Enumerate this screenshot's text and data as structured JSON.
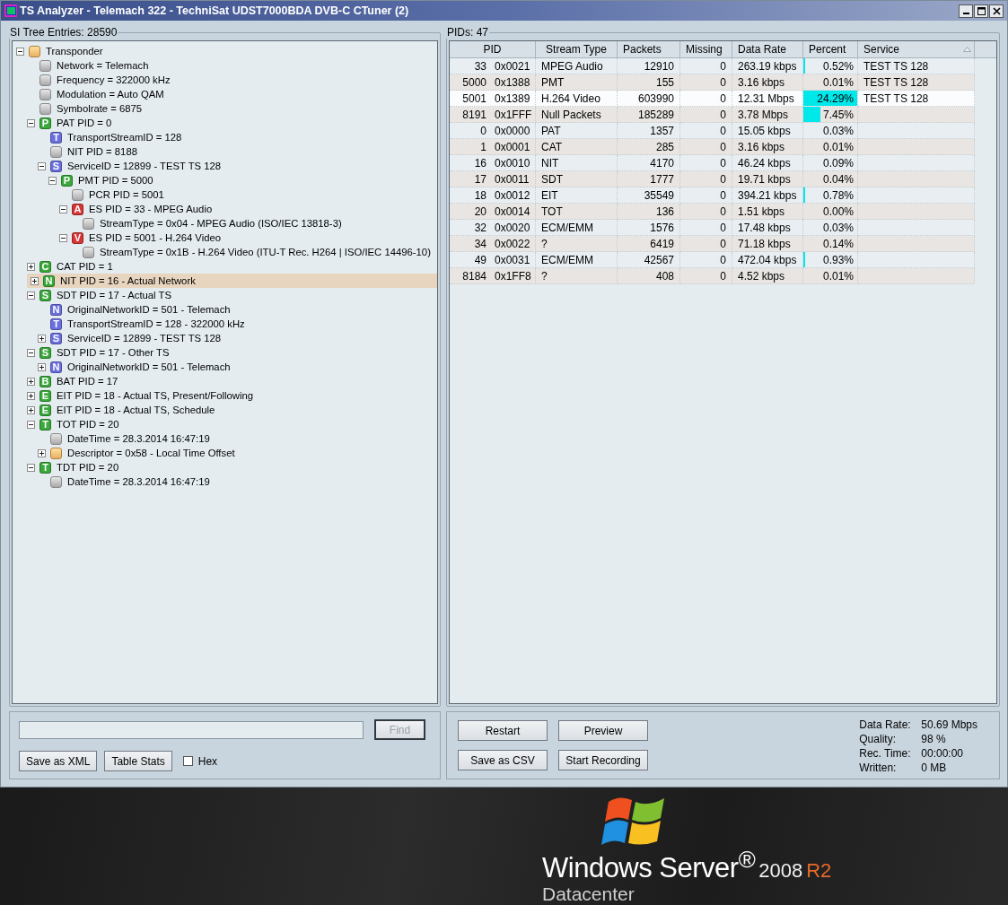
{
  "window": {
    "title": "TS Analyzer - Telemach 322 - TechniSat UDST7000BDA DVB-C CTuner (2)"
  },
  "tree_panel": {
    "title": "SI Tree Entries: 28590",
    "nodes": [
      {
        "label": "Transponder",
        "kind": "folder",
        "expanded": true,
        "selected": false,
        "children": [
          {
            "label": "Network = Telemach",
            "kind": "plain",
            "selected": false
          },
          {
            "label": "Frequency = 322000 kHz",
            "kind": "plain",
            "selected": false
          },
          {
            "label": "Modulation = Auto QAM",
            "kind": "plain",
            "selected": false
          },
          {
            "label": "Symbolrate = 6875",
            "kind": "plain",
            "selected": false
          },
          {
            "label": "PAT PID = 0",
            "kind": "letter",
            "badge": "P",
            "color": "#3aa83a",
            "expanded": true,
            "selected": false,
            "children": [
              {
                "label": "TransportStreamID = 128",
                "kind": "letter",
                "badge": "T",
                "color": "#6b6fe0",
                "selected": false
              },
              {
                "label": "NIT PID = 8188",
                "kind": "plain",
                "selected": false
              },
              {
                "label": "ServiceID = 12899 - TEST TS 128",
                "kind": "letter",
                "badge": "S",
                "color": "#6b6fe0",
                "expanded": true,
                "selected": false,
                "children": [
                  {
                    "label": "PMT PID = 5000",
                    "kind": "letter",
                    "badge": "P",
                    "color": "#3aa83a",
                    "expanded": true,
                    "selected": false,
                    "children": [
                      {
                        "label": "PCR PID = 5001",
                        "kind": "plain",
                        "selected": false
                      },
                      {
                        "label": "ES PID = 33 - MPEG Audio",
                        "kind": "letter",
                        "badge": "A",
                        "color": "#d83434",
                        "expanded": true,
                        "selected": false,
                        "children": [
                          {
                            "label": "StreamType = 0x04 - MPEG Audio (ISO/IEC 13818-3)",
                            "kind": "plain",
                            "selected": false
                          }
                        ]
                      },
                      {
                        "label": "ES PID = 5001 - H.264 Video",
                        "kind": "letter",
                        "badge": "V",
                        "color": "#d83434",
                        "expanded": true,
                        "selected": false,
                        "children": [
                          {
                            "label": "StreamType = 0x1B - H.264 Video (ITU-T Rec. H264 | ISO/IEC 14496-10)",
                            "kind": "plain",
                            "selected": false
                          }
                        ]
                      }
                    ]
                  }
                ]
              }
            ]
          },
          {
            "label": "CAT PID = 1",
            "kind": "letter",
            "badge": "C",
            "color": "#3aa83a",
            "expanded": false,
            "selected": false
          },
          {
            "label": "NIT PID = 16 - Actual Network",
            "kind": "letter",
            "badge": "N",
            "color": "#3aa83a",
            "expanded": false,
            "selected": true
          },
          {
            "label": "SDT PID = 17 - Actual TS",
            "kind": "letter",
            "badge": "S",
            "color": "#3aa83a",
            "expanded": true,
            "selected": false,
            "children": [
              {
                "label": "OriginalNetworkID = 501 - Telemach",
                "kind": "letter",
                "badge": "N",
                "color": "#6b6fe0",
                "selected": false
              },
              {
                "label": "TransportStreamID = 128 - 322000 kHz",
                "kind": "letter",
                "badge": "T",
                "color": "#6b6fe0",
                "selected": false
              },
              {
                "label": "ServiceID = 12899 - TEST TS 128",
                "kind": "letter",
                "badge": "S",
                "color": "#6b6fe0",
                "expanded": false,
                "selected": false
              }
            ]
          },
          {
            "label": "SDT PID = 17 - Other TS",
            "kind": "letter",
            "badge": "S",
            "color": "#3aa83a",
            "expanded": true,
            "selected": false,
            "children": [
              {
                "label": "OriginalNetworkID = 501 - Telemach",
                "kind": "letter",
                "badge": "N",
                "color": "#6b6fe0",
                "expanded": false,
                "selected": false
              }
            ]
          },
          {
            "label": "BAT PID = 17",
            "kind": "letter",
            "badge": "B",
            "color": "#3aa83a",
            "expanded": false,
            "selected": false
          },
          {
            "label": "EIT PID = 18 - Actual TS, Present/Following",
            "kind": "letter",
            "badge": "E",
            "color": "#3aa83a",
            "expanded": false,
            "selected": false
          },
          {
            "label": "EIT PID = 18 - Actual TS, Schedule",
            "kind": "letter",
            "badge": "E",
            "color": "#3aa83a",
            "expanded": false,
            "selected": false
          },
          {
            "label": "TOT PID = 20",
            "kind": "letter",
            "badge": "T",
            "color": "#3aa83a",
            "expanded": true,
            "selected": false,
            "children": [
              {
                "label": "DateTime = 28.3.2014 16:47:19",
                "kind": "plain",
                "selected": false
              },
              {
                "label": "Descriptor = 0x58 - Local Time Offset",
                "kind": "folder",
                "expanded": false,
                "selected": false
              }
            ]
          },
          {
            "label": "TDT PID = 20",
            "kind": "letter",
            "badge": "T",
            "color": "#3aa83a",
            "expanded": true,
            "selected": false,
            "children": [
              {
                "label": "DateTime = 28.3.2014 16:47:19",
                "kind": "plain",
                "selected": false
              }
            ]
          }
        ]
      }
    ]
  },
  "search": {
    "find_button": "Find",
    "find_disabled": true
  },
  "left_buttons": [
    "Save as XML",
    "Table Stats"
  ],
  "hex_checkbox": {
    "label": "Hex",
    "checked": false
  },
  "pid_panel": {
    "title": "PIDs: 47",
    "columns": [
      {
        "label": "PID",
        "sorted": false
      },
      {
        "label": "Stream Type",
        "sorted": false
      },
      {
        "label": "Packets",
        "sorted": false
      },
      {
        "label": "Missing",
        "sorted": false
      },
      {
        "label": "Data Rate",
        "sorted": false
      },
      {
        "label": "Percent",
        "sorted": false
      },
      {
        "label": "Service",
        "sorted": true
      }
    ],
    "rows": [
      {
        "pid": "33",
        "hex": "0x0021",
        "stream_type": "MPEG Audio",
        "packets": "12910",
        "missing": "0",
        "data_rate": "263.19 kbps",
        "percent": "0.52%",
        "level": 0.02,
        "service": "TEST TS 128",
        "selected": false
      },
      {
        "pid": "5000",
        "hex": "0x1388",
        "stream_type": "PMT",
        "packets": "155",
        "missing": "0",
        "data_rate": "3.16 kbps",
        "percent": "0.01%",
        "service": "TEST TS 128",
        "selected": false
      },
      {
        "pid": "5001",
        "hex": "0x1389",
        "stream_type": "H.264 Video",
        "packets": "603990",
        "missing": "0",
        "data_rate": "12.31 Mbps",
        "percent": "24.29%",
        "level": 1,
        "service": "TEST TS 128",
        "selected": true
      },
      {
        "pid": "8191",
        "hex": "0x1FFF",
        "stream_type": "Null Packets",
        "packets": "185289",
        "missing": "0",
        "data_rate": "3.78 Mbps",
        "percent": "7.45%",
        "level": 0.31,
        "selected": false
      },
      {
        "pid": "0",
        "hex": "0x0000",
        "stream_type": "PAT",
        "packets": "1357",
        "missing": "0",
        "data_rate": "15.05 kbps",
        "percent": "0.03%",
        "selected": false
      },
      {
        "pid": "1",
        "hex": "0x0001",
        "stream_type": "CAT",
        "packets": "285",
        "missing": "0",
        "data_rate": "3.16 kbps",
        "percent": "0.01%",
        "selected": false
      },
      {
        "pid": "16",
        "hex": "0x0010",
        "stream_type": "NIT",
        "packets": "4170",
        "missing": "0",
        "data_rate": "46.24 kbps",
        "percent": "0.09%",
        "selected": false
      },
      {
        "pid": "17",
        "hex": "0x0011",
        "stream_type": "SDT",
        "packets": "1777",
        "missing": "0",
        "data_rate": "19.71 kbps",
        "percent": "0.04%",
        "selected": false
      },
      {
        "pid": "18",
        "hex": "0x0012",
        "stream_type": "EIT",
        "packets": "35549",
        "missing": "0",
        "data_rate": "394.21 kbps",
        "percent": "0.78%",
        "level": 0.03,
        "selected": false
      },
      {
        "pid": "20",
        "hex": "0x0014",
        "stream_type": "TOT",
        "packets": "136",
        "missing": "0",
        "data_rate": "1.51 kbps",
        "percent": "0.00%",
        "selected": false
      },
      {
        "pid": "32",
        "hex": "0x0020",
        "stream_type": "ECM/EMM",
        "packets": "1576",
        "missing": "0",
        "data_rate": "17.48 kbps",
        "percent": "0.03%",
        "selected": false
      },
      {
        "pid": "34",
        "hex": "0x0022",
        "stream_type": "?",
        "packets": "6419",
        "missing": "0",
        "data_rate": "71.18 kbps",
        "percent": "0.14%",
        "selected": false
      },
      {
        "pid": "49",
        "hex": "0x0031",
        "stream_type": "ECM/EMM",
        "packets": "42567",
        "missing": "0",
        "data_rate": "472.04 kbps",
        "percent": "0.93%",
        "level": 0.04,
        "selected": false
      },
      {
        "pid": "8184",
        "hex": "0x1FF8",
        "stream_type": "?",
        "packets": "408",
        "missing": "0",
        "data_rate": "4.52 kbps",
        "percent": "0.01%",
        "selected": false
      }
    ]
  },
  "right_buttons": [
    "Restart",
    "Preview",
    "Save as CSV",
    "Start Recording"
  ],
  "stats": [
    {
      "label": "Data Rate:",
      "value": "50.69 Mbps"
    },
    {
      "label": "Quality:",
      "value": "98 %"
    },
    {
      "label": "Rec. Time:",
      "value": "00:00:00"
    },
    {
      "label": "Written:",
      "value": "0 MB"
    }
  ],
  "desktop": {
    "brand": "Windows Server$^{®}$",
    "version": "2008",
    "release": "R2",
    "edition": "Datacenter"
  }
}
